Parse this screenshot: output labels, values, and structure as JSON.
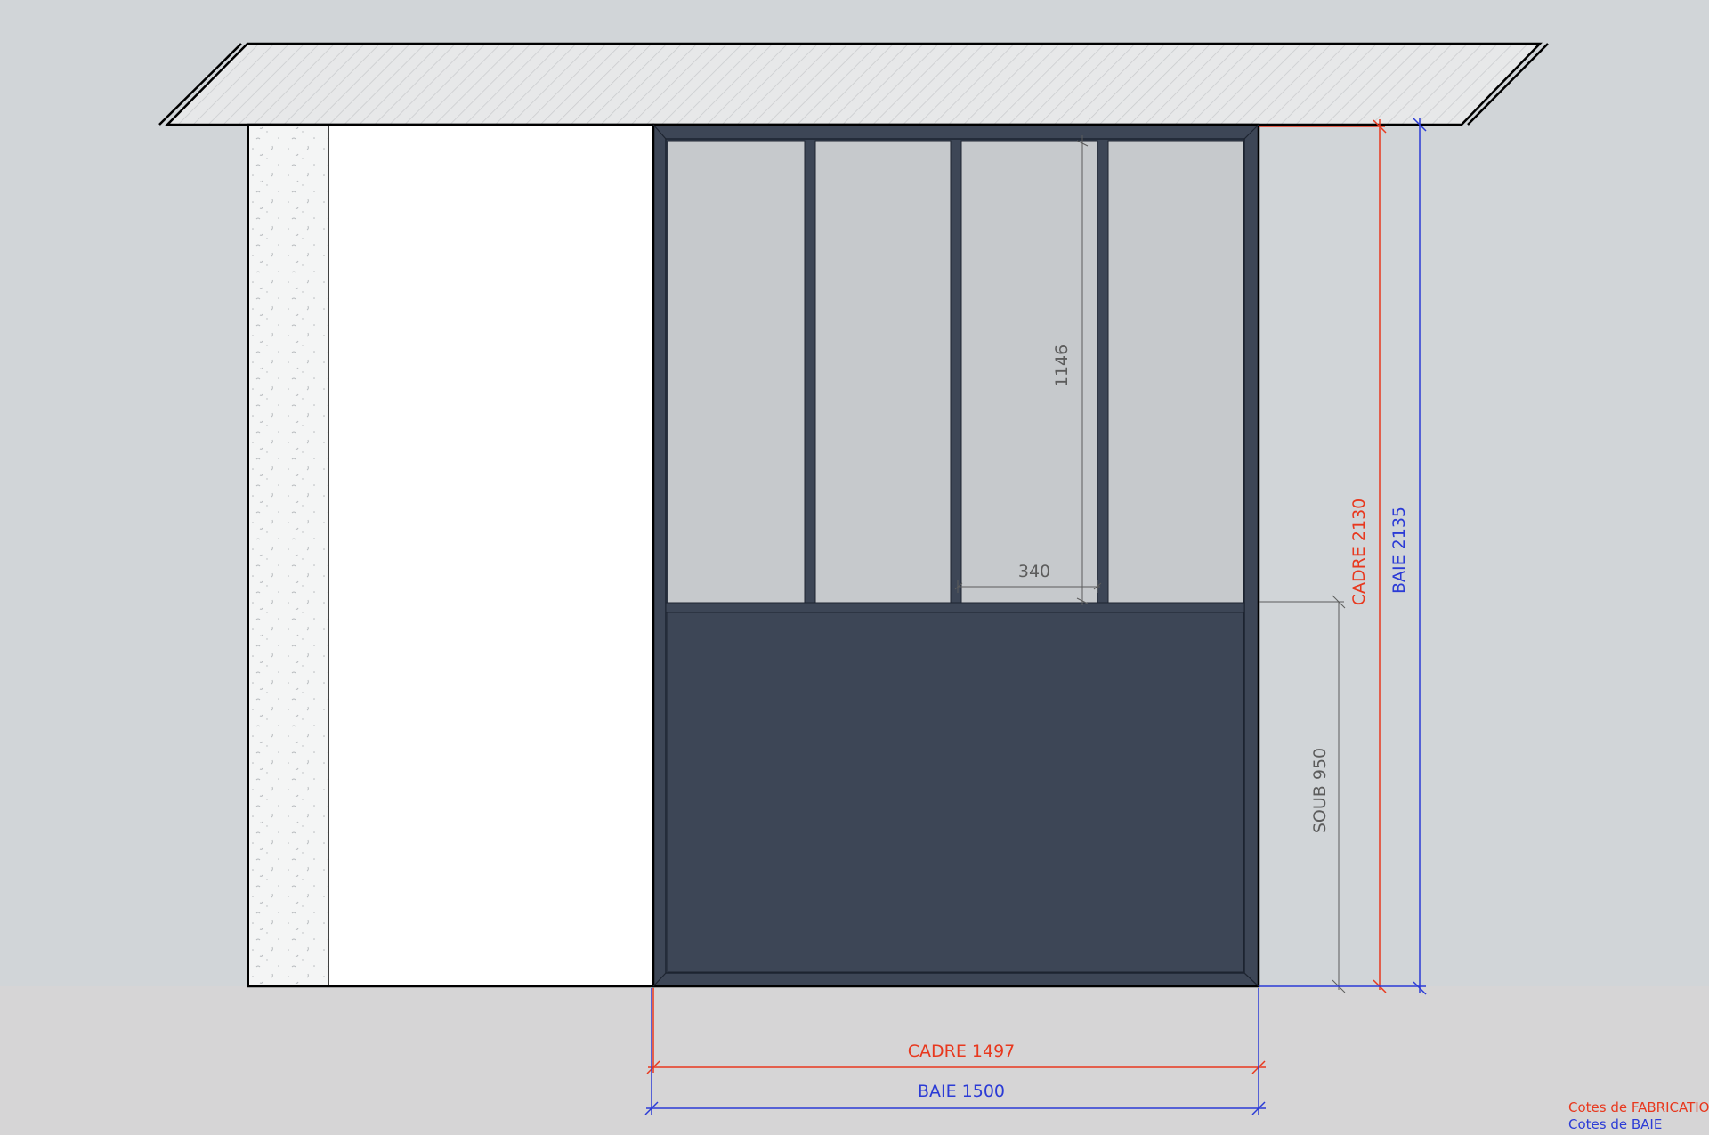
{
  "colors": {
    "background": "#d1d5d8",
    "floor": "#d6d5d6",
    "slab_fill": "#e7e8e9",
    "slab_hatch": "#c9cbcd",
    "wall_fill": "#ffffff",
    "insulation_fill": "#f4f5f5",
    "frame": "#3d4656",
    "glass": "#c6c9cc",
    "outline": "#000000",
    "fabrication": "#e8381e",
    "baie": "#2b3bd6",
    "neutral_dim": "#5c5c5c"
  },
  "dimensions": {
    "glass_height": "1146",
    "pane_width": "340",
    "soubassement": "SOUB 950",
    "cadre_height": "CADRE 2130",
    "baie_height": "BAIE 2135",
    "cadre_width": "CADRE 1497",
    "baie_width": "BAIE 1500"
  },
  "legend": {
    "fabrication": "Cotes de FABRICATION",
    "baie": "Cotes de BAIE"
  }
}
